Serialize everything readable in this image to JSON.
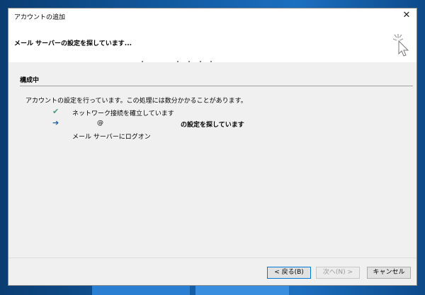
{
  "window": {
    "title": "アカウントの追加",
    "close_glyph": "✕"
  },
  "header": {
    "title": "メール サーバーの設定を探しています...",
    "icon": "setup-wizard-sparkle-cursor-icon"
  },
  "section": {
    "title": "構成中"
  },
  "intro_text": "アカウントの設定を行っています。この処理には数分かかることがあります。",
  "steps": [
    {
      "status": "done",
      "icon": "checkmark-icon",
      "glyph": "✔",
      "text": "ネットワーク接続を確立しています"
    },
    {
      "status": "in-progress",
      "icon": "arrow-right-icon",
      "glyph": "➔",
      "at_symbol": "@",
      "text": "の設定を探しています"
    },
    {
      "status": "pending",
      "text": "メール サーバーにログオン"
    }
  ],
  "buttons": {
    "back": "< 戻る(B)",
    "next": "次へ(N) >",
    "cancel": "キャンセル"
  },
  "colors": {
    "desktop": "#115aa0",
    "dialog_bg": "#f0f0f0",
    "check": "#4b9a7a",
    "arrow": "#1f5fa8",
    "focus_border": "#0078d7"
  }
}
